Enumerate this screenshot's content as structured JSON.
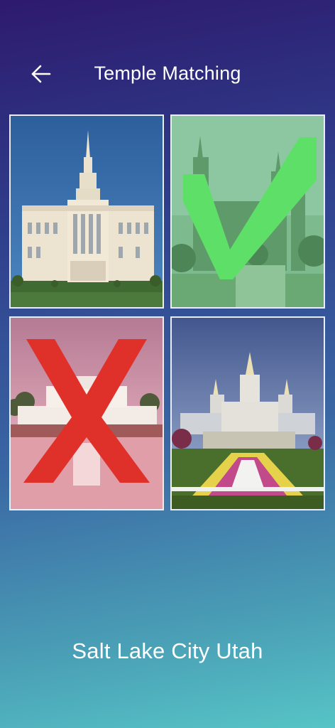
{
  "header": {
    "title": "Temple Matching",
    "back_icon": "arrow-left-icon"
  },
  "tiles": [
    {
      "id": "payson",
      "state": "neutral"
    },
    {
      "id": "salt-lake",
      "state": "correct",
      "overlay_color": "#5ee068"
    },
    {
      "id": "laie",
      "state": "wrong",
      "overlay_color": "#e0302a"
    },
    {
      "id": "oakland",
      "state": "neutral"
    }
  ],
  "prompt": {
    "temple_name": "Salt Lake City Utah"
  },
  "colors": {
    "correct": "#5ee068",
    "wrong": "#e0302a",
    "tile_border": "#e9eef6"
  }
}
